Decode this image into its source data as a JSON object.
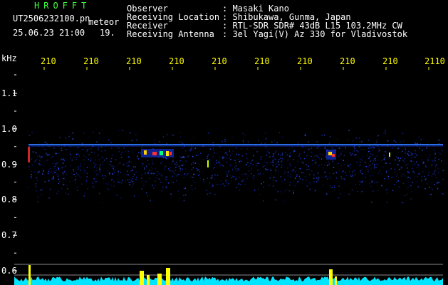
{
  "app": {
    "brand": "HROFFT",
    "file_name": "UT2506232100.pn",
    "mode_label": "meteor",
    "timestamp": "25.06.23 21:00",
    "count": "19."
  },
  "info": {
    "labels": [
      "Observer",
      "Receiving Location",
      "Receiver",
      "Receiving Antenna"
    ],
    "values": [
      ": Masaki Kano",
      ": Shibukawa, Gunma, Japan",
      ": RTL-SDR SDR# 43dB L15 103.2MHz CW",
      ": 3el Yagi(V) Az 330 for Vladivostok"
    ]
  },
  "axes": {
    "y_unit": "kHz",
    "y_ticks": [
      "1.1",
      "1.0",
      "0.9",
      "0.8",
      "0.7",
      "0.6"
    ],
    "x_ticks": [
      "210",
      "210",
      "210",
      "210",
      "210",
      "210",
      "210",
      "210",
      "210",
      "2110"
    ]
  },
  "colors": {
    "background": "#000000",
    "text": "#ffffff",
    "axis_label": "#ffff00",
    "brand": "#3cff3c",
    "signal_line": "#2e7bff",
    "meteor": "#ff3030",
    "meter_cyan": "#00e5ff",
    "meter_yellow": "#ffff00"
  }
}
